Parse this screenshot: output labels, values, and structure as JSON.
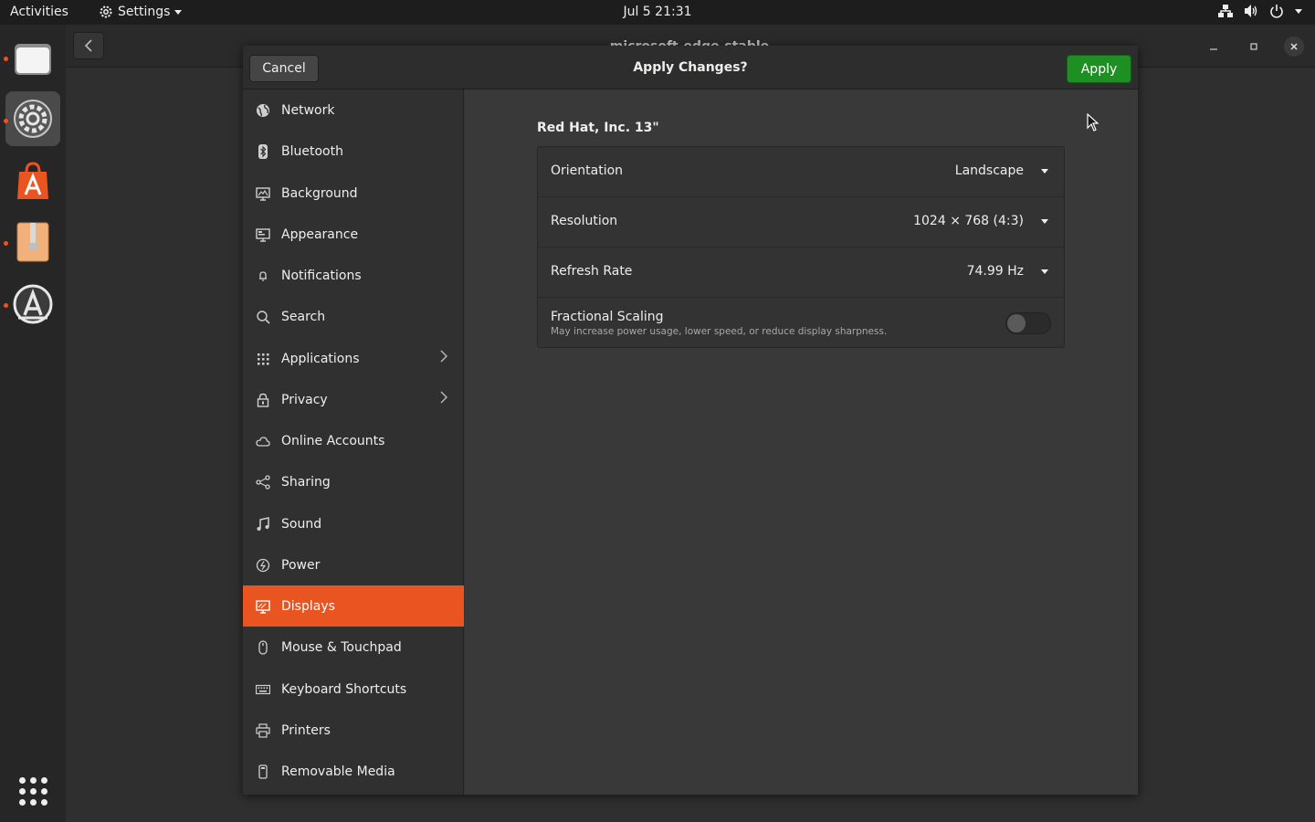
{
  "topbar": {
    "activities": "Activities",
    "app_menu": "Settings",
    "clock": "Jul 5  21:31"
  },
  "dock": {
    "items": [
      {
        "icon": "files-icon"
      },
      {
        "icon": "settings-gear-icon"
      },
      {
        "icon": "software-center-icon"
      },
      {
        "icon": "archive-manager-icon"
      },
      {
        "icon": "software-updater-icon"
      },
      {
        "icon": "show-applications-icon"
      }
    ]
  },
  "background_window": {
    "title": "microsoft-edge-stable"
  },
  "settings_window": {
    "header": {
      "cancel_label": "Cancel",
      "title": "Apply Changes?",
      "apply_label": "Apply"
    },
    "sidebar": {
      "items": [
        {
          "label": "Network",
          "icon": "network-icon"
        },
        {
          "label": "Bluetooth",
          "icon": "bluetooth-icon"
        },
        {
          "label": "Background",
          "icon": "background-icon"
        },
        {
          "label": "Appearance",
          "icon": "appearance-icon"
        },
        {
          "label": "Notifications",
          "icon": "bell-icon"
        },
        {
          "label": "Search",
          "icon": "search-icon"
        },
        {
          "label": "Applications",
          "icon": "apps-grid-icon",
          "has_submenu": true
        },
        {
          "label": "Privacy",
          "icon": "lock-icon",
          "has_submenu": true
        },
        {
          "label": "Online Accounts",
          "icon": "cloud-icon"
        },
        {
          "label": "Sharing",
          "icon": "share-icon"
        },
        {
          "label": "Sound",
          "icon": "music-note-icon"
        },
        {
          "label": "Power",
          "icon": "power-icon"
        },
        {
          "label": "Displays",
          "icon": "display-icon",
          "selected": true
        },
        {
          "label": "Mouse & Touchpad",
          "icon": "mouse-icon"
        },
        {
          "label": "Keyboard Shortcuts",
          "icon": "keyboard-icon"
        },
        {
          "label": "Printers",
          "icon": "printer-icon"
        },
        {
          "label": "Removable Media",
          "icon": "removable-media-icon"
        }
      ]
    },
    "displays": {
      "monitor_name": "Red Hat, Inc. 13\"",
      "orientation": {
        "label": "Orientation",
        "value": "Landscape"
      },
      "resolution": {
        "label": "Resolution",
        "value": "1024 × 768 (4:3)"
      },
      "refresh_rate": {
        "label": "Refresh Rate",
        "value": "74.99 Hz"
      },
      "fractional_scaling": {
        "label": "Fractional Scaling",
        "description": "May increase power usage, lower speed, or reduce display sharpness.",
        "enabled": false
      }
    }
  },
  "colors": {
    "accent": "#e95420",
    "apply_green": "#1e8f23"
  }
}
